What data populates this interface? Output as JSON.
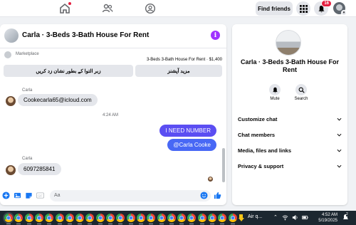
{
  "nav": {
    "find_friends": "Find friends",
    "notif_count": "16",
    "icons": [
      "home-icon",
      "friends-icon",
      "groups-icon",
      "menu-grid-icon",
      "bell-icon",
      "profile-avatar"
    ]
  },
  "chat": {
    "title": "Carla · 3-Beds 3-Bath House For Rent",
    "marketplace_label": "Marketplace",
    "listing": "3-Beds 3-Bath House For Rent · $1,400",
    "action_left": "زبر التوا کے بطور نشان زد کریں",
    "action_right": "مزید آپشنز",
    "messages": [
      {
        "sender": "Carla",
        "text": "Cookecarla65@icloud.com",
        "direction": "in"
      },
      {
        "timestamp": "4:24 AM"
      },
      {
        "text": "I NEED NUMBER",
        "direction": "out"
      },
      {
        "text": "@Carla Cooke",
        "direction": "out"
      },
      {
        "sender": "Carla",
        "text": "6097285841",
        "direction": "in"
      }
    ],
    "composer_placeholder": "Aa"
  },
  "side": {
    "title": "Carla · 3-Beds 3-Bath House For Rent",
    "mute_label": "Mute",
    "search_label": "Search",
    "rows": [
      "Customize chat",
      "Chat members",
      "Media, files and links",
      "Privacy & support"
    ]
  },
  "taskbar": {
    "weather": "Air q...",
    "time": "4:52 AM",
    "date": "5/19/2025",
    "notif_count": "2",
    "app_count": 23
  },
  "colors": {
    "accent": "#5b4ef2",
    "accent2": "#4868f5",
    "info": "#a033ff",
    "badge": "#e41e3f",
    "taskbar": "#1c2730"
  }
}
